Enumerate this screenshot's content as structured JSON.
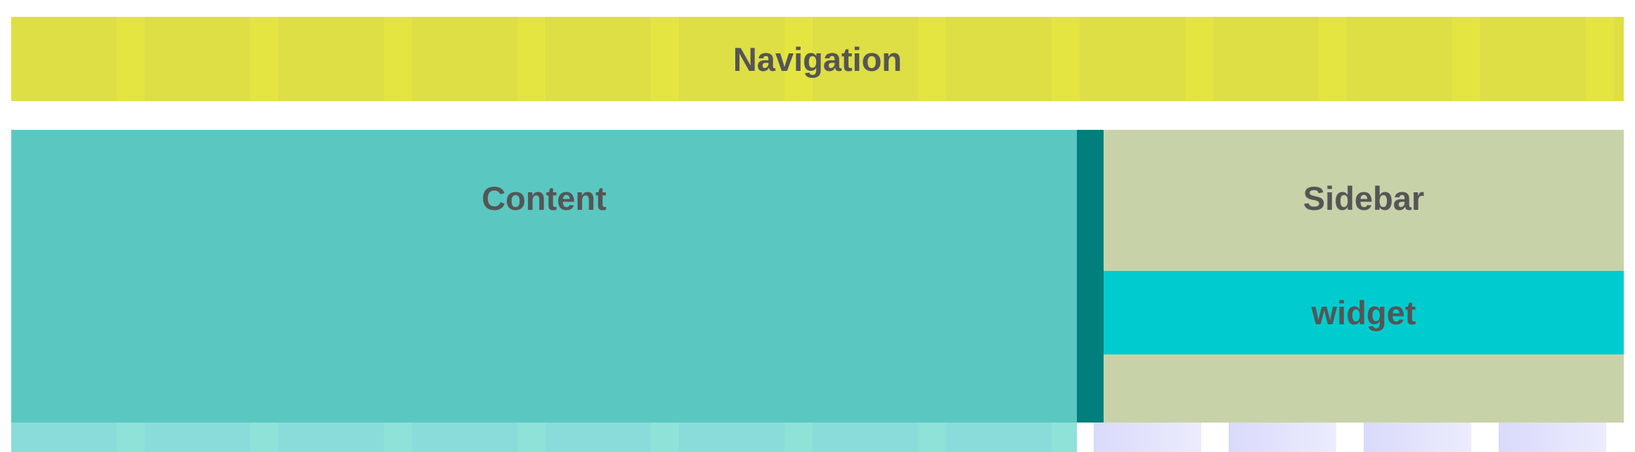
{
  "layout_demo": {
    "navigation": {
      "label": "Navigation",
      "background_color": "#DEDE45"
    },
    "content": {
      "label": "Content",
      "background_color": "#5AC8C1"
    },
    "sidebar": {
      "label": "Sidebar",
      "background_color": "#C8D2A8",
      "widget": {
        "label": "widget",
        "background_color": "#00CCCF"
      }
    },
    "footer": {
      "left_color": "#89DCD9",
      "right_blocks_color": "#E0E0FC"
    }
  }
}
